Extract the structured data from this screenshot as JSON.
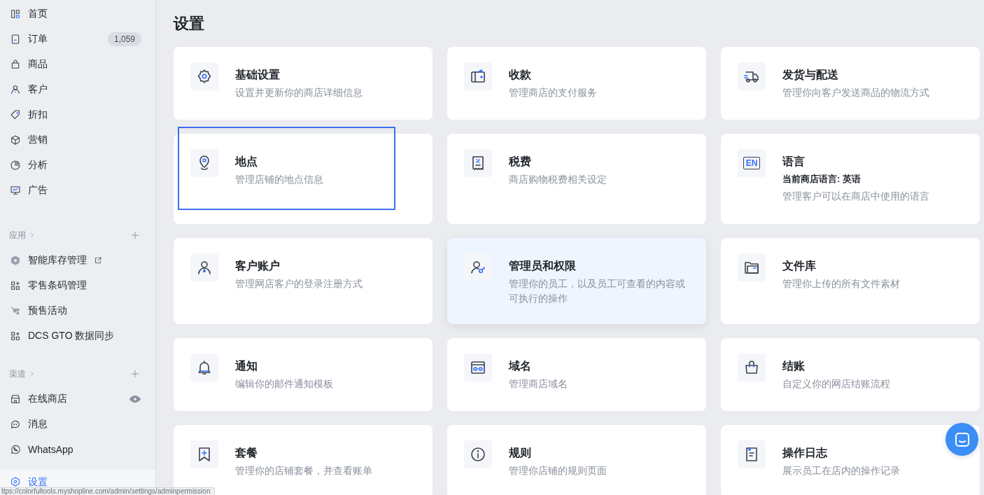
{
  "sidebar": {
    "nav": [
      {
        "label": "首页",
        "selected": false
      },
      {
        "label": "订单",
        "badge": "1,059",
        "selected": false
      },
      {
        "label": "商品",
        "selected": false
      },
      {
        "label": "客户",
        "selected": false
      },
      {
        "label": "折扣",
        "selected": false
      },
      {
        "label": "营销",
        "selected": false
      },
      {
        "label": "分析",
        "selected": false
      },
      {
        "label": "广告",
        "selected": false
      }
    ],
    "sections": [
      {
        "title": "应用",
        "items": [
          {
            "label": "智能库存管理",
            "external": true,
            "selected": false
          },
          {
            "label": "零售条码管理",
            "external": false,
            "selected": false
          },
          {
            "label": "预售活动",
            "external": false,
            "selected": false
          },
          {
            "label": "DCS GTO 数据同步",
            "external": false,
            "selected": false
          }
        ]
      },
      {
        "title": "渠道",
        "items": [
          {
            "label": "在线商店",
            "external": false,
            "viewable": true,
            "selected": false
          },
          {
            "label": "消息",
            "external": false,
            "viewable": false,
            "selected": false
          },
          {
            "label": "WhatsApp",
            "external": false,
            "viewable": false,
            "selected": false
          }
        ]
      }
    ],
    "footer": {
      "label": "设置",
      "selected": true
    }
  },
  "page": {
    "title": "设置"
  },
  "cards": [
    {
      "title": "基础设置",
      "description": "设置并更新你的商店详细信息",
      "focused": false,
      "highlighted": false
    },
    {
      "title": "收款",
      "description": "管理商店的支付服务",
      "focused": false,
      "highlighted": false
    },
    {
      "title": "发货与配送",
      "description": "管理你向客户发送商品的物流方式",
      "focused": false,
      "highlighted": false
    },
    {
      "title": "地点",
      "description": "管理店铺的地点信息",
      "focused": true,
      "highlighted": false
    },
    {
      "title": "税费",
      "description": "商店购物税费相关设定",
      "focused": false,
      "highlighted": false
    },
    {
      "title": "语言",
      "icon_text": "EN",
      "current": "当前商店语言: 英语",
      "description": "管理客户可以在商店中使用的语言",
      "focused": false,
      "highlighted": false
    },
    {
      "title": "客户账户",
      "description": "管理网店客户的登录注册方式",
      "focused": false,
      "highlighted": false
    },
    {
      "title": "管理员和权限",
      "description": "管理你的员工，以及员工可查看的内容或可执行的操作",
      "focused": false,
      "highlighted": true
    },
    {
      "title": "文件库",
      "description": "管理你上传的所有文件素材",
      "focused": false,
      "highlighted": false
    },
    {
      "title": "通知",
      "description": "编辑你的邮件通知模板",
      "focused": false,
      "highlighted": false
    },
    {
      "title": "域名",
      "description": "管理商店域名",
      "focused": false,
      "highlighted": false
    },
    {
      "title": "结账",
      "description": "自定义你的网店结账流程",
      "focused": false,
      "highlighted": false
    },
    {
      "title": "套餐",
      "description": "管理你的店铺套餐，并查看账单",
      "focused": false,
      "highlighted": false
    },
    {
      "title": "规则",
      "description": "管理你店铺的规则页面",
      "focused": false,
      "highlighted": false
    },
    {
      "title": "操作日志",
      "description": "展示员工在店内的操作记录",
      "focused": false,
      "highlighted": false
    }
  ],
  "status_url": "ttps://colorfultools.myshopline.com/admin/settings/adminpermission"
}
